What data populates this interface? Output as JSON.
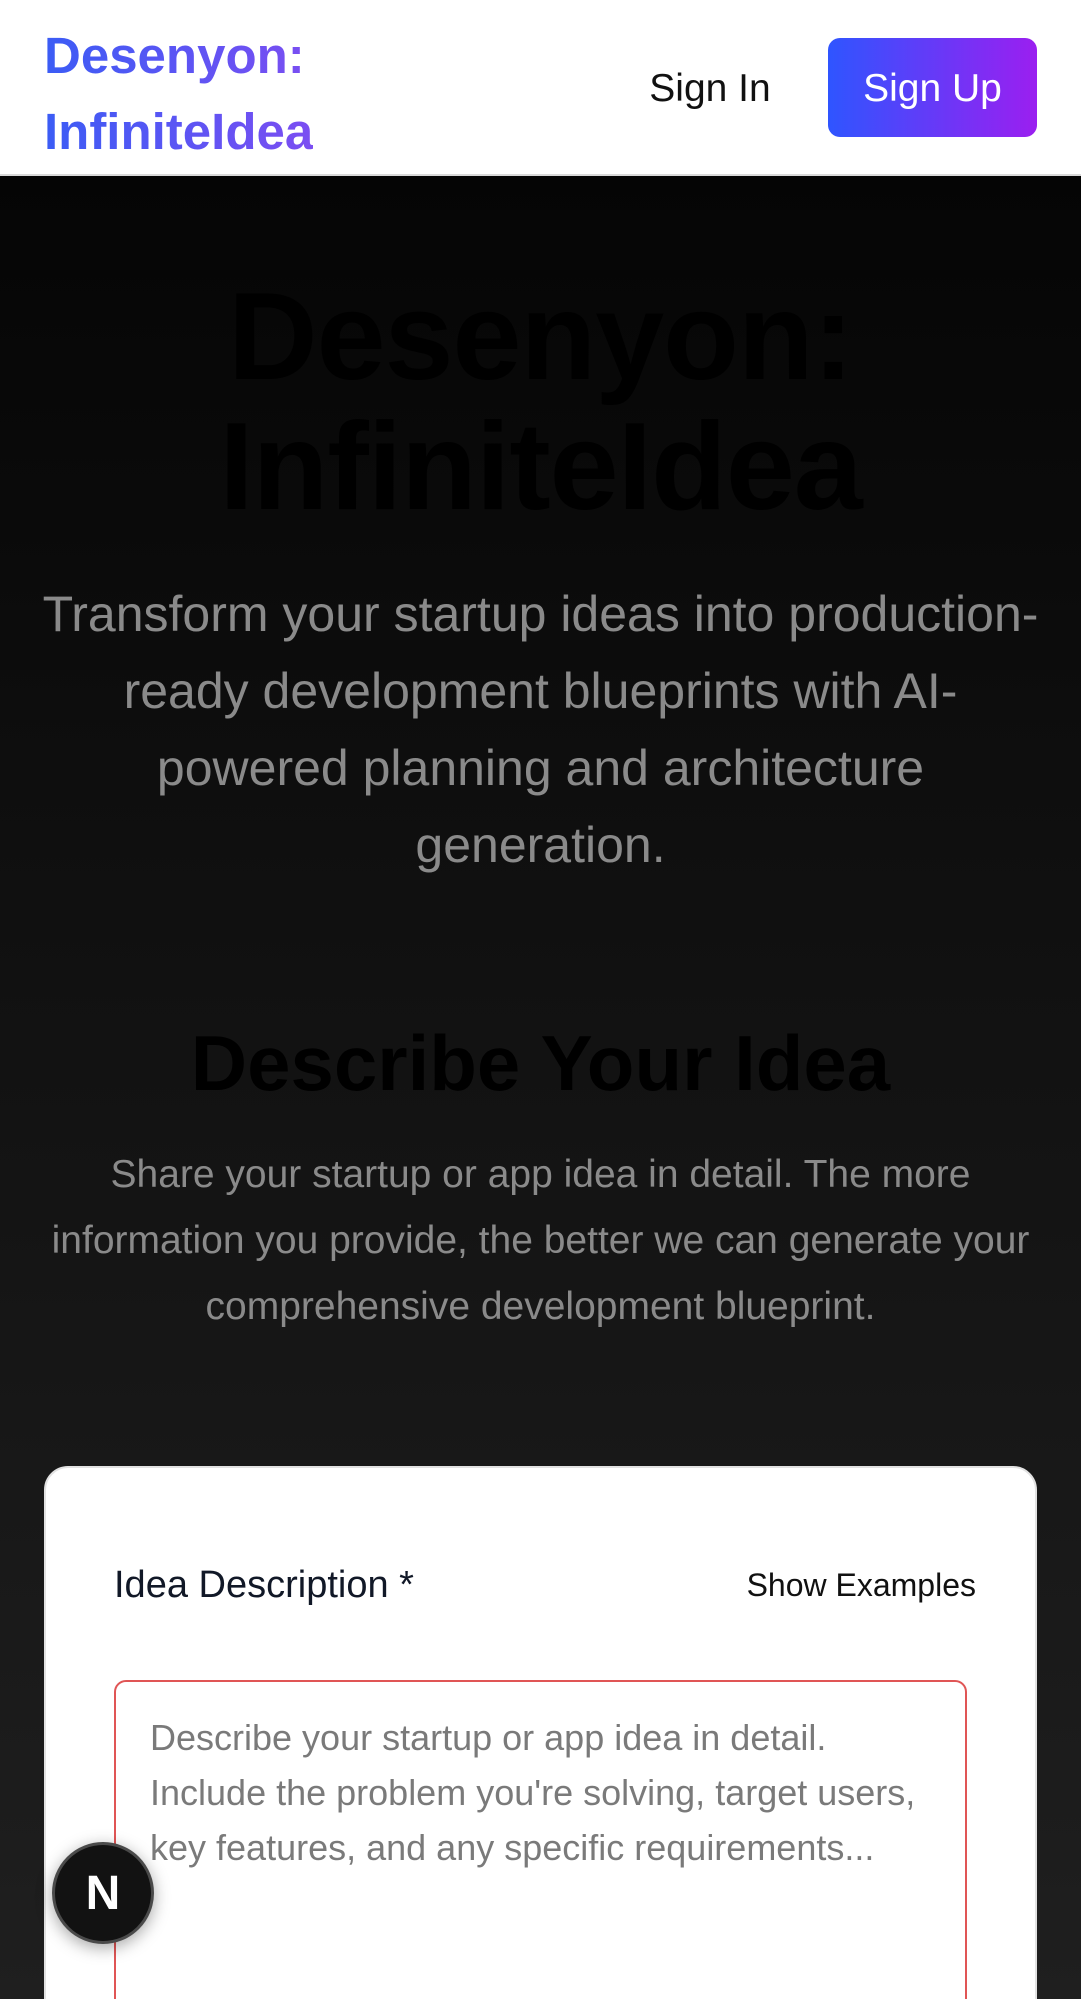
{
  "header": {
    "logo_line1": "Desenyon:",
    "logo_line2": "InfiniteIdea",
    "signin_label": "Sign In",
    "signup_label": "Sign Up"
  },
  "hero": {
    "title_line1": "Desenyon:",
    "title_line2": "InfiniteIdea",
    "subtitle": "Transform your startup ideas into production-ready development blueprints with AI-powered planning and architecture generation."
  },
  "section": {
    "title": "Describe Your Idea",
    "description": "Share your startup or app idea in detail. The more information you provide, the better we can generate your comprehensive development blueprint."
  },
  "form": {
    "label": "Idea Description *",
    "show_examples_label": "Show Examples",
    "placeholder": "Describe your startup or app idea in detail. Include the problem you're solving, target users, key features, and any specific requirements...",
    "value": ""
  },
  "floating_badge": {
    "letter": "N",
    "icon": "nextjs-logo-icon"
  },
  "colors": {
    "brand_gradient_start": "#2f55ff",
    "brand_gradient_end": "#9b1ff0",
    "input_border_error": "#e05555"
  }
}
